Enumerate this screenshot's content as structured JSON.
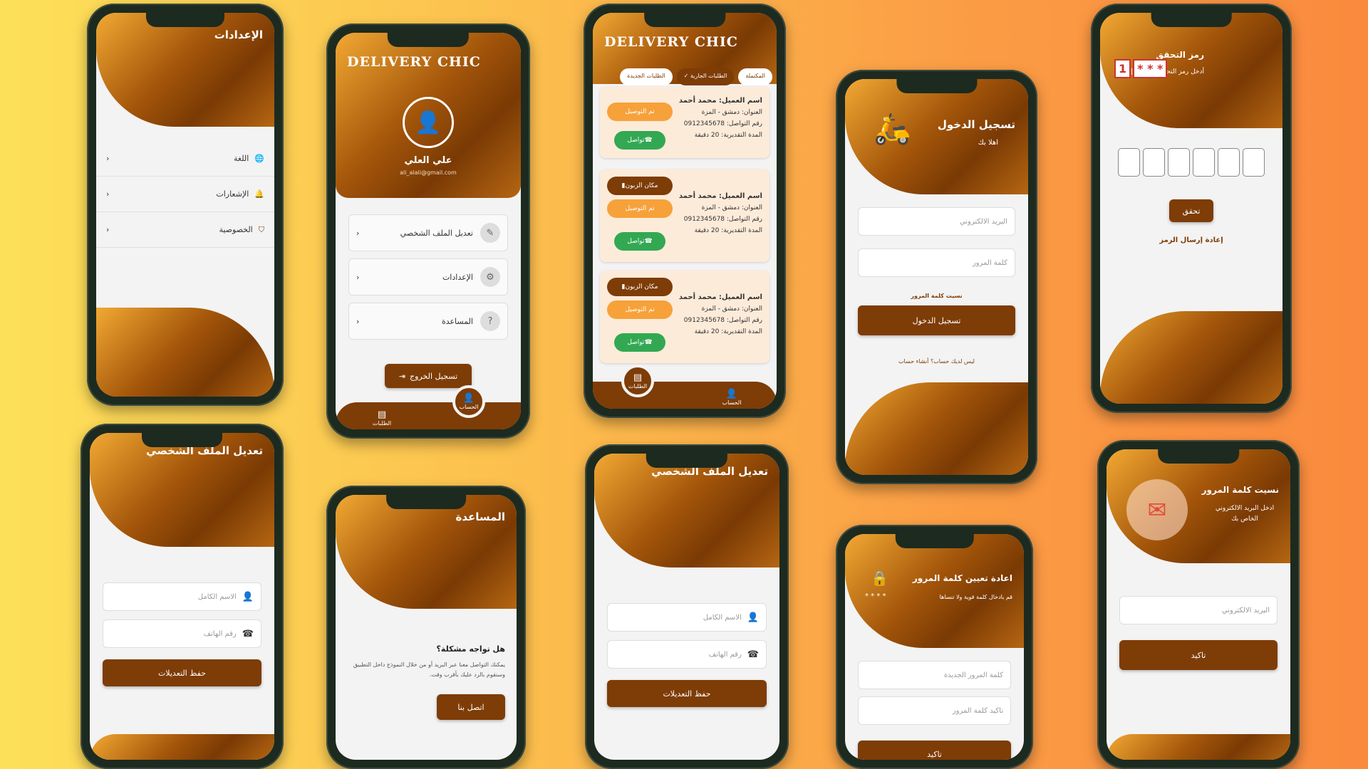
{
  "colors": {
    "brown": "#7e3c06",
    "orange": "#f7a13a",
    "green": "#33a852"
  },
  "settings_screen": {
    "title": "الإعدادات",
    "rows": [
      {
        "label": "اللغة",
        "icon": "globe-icon"
      },
      {
        "label": "الإشعارات",
        "icon": "bell-icon"
      },
      {
        "label": "الخصوصية",
        "icon": "shield-icon"
      }
    ]
  },
  "profile_screen": {
    "brand": "DELIVERY CHIC",
    "user_name": "علي العلي",
    "user_email": "ali_alali@gmail.com",
    "menu": [
      {
        "label": "تعديل الملف الشخصي",
        "icon": "pencil-icon"
      },
      {
        "label": "الإعدادات",
        "icon": "gear-icon"
      },
      {
        "label": "المساعدة",
        "icon": "help-icon"
      }
    ],
    "logout": "تسجيل الخروج",
    "nav": {
      "orders": "الطلبات",
      "account": "الحساب"
    }
  },
  "orders_screen": {
    "brand": "DELIVERY CHIC",
    "tabs": [
      "المكتملة",
      "الطلبات الجارية",
      "الطلبات الجديدة"
    ],
    "cards": [
      {
        "name": "اسم العميل: محمد أحمد",
        "address": "العنوان: دمشق - المزة",
        "phone": "رقم التواصل: 0912345678",
        "eta": "المدة التقديرية: 20 دقيقة"
      },
      {
        "name": "اسم العميل: محمد أحمد",
        "address": "العنوان: دمشق - المزة",
        "phone": "رقم التواصل: 0912345678",
        "eta": "المدة التقديرية: 20 دقيقة"
      },
      {
        "name": "اسم العميل: محمد أحمد",
        "address": "العنوان: دمشق - المزة",
        "phone": "رقم التواصل: 0912345678",
        "eta": "المدة التقديرية: 20 دقيقة"
      }
    ],
    "chip_map": "مكان الزبون",
    "chip_done": "تم التوصيل",
    "chip_call": "تواصل",
    "nav": {
      "orders": "الطلبات",
      "account": "الحساب"
    }
  },
  "login_screen": {
    "title": "تسجيل الدخول",
    "subtitle": "اهلا بك",
    "email_placeholder": "البريد الالكتروني",
    "password_placeholder": "كلمة المرور",
    "forgot": "نسيت كلمة المرور",
    "submit": "تسجيل الدخول",
    "signup": "ليس لديك حساب؟ أنشاء حساب"
  },
  "otp_screen": {
    "title": "رمز التحقق",
    "subtitle": "أدخل رمز التحقق المرسل إلى",
    "verify": "تحقق",
    "resend": "إعادة إرسال الرمز",
    "illustration_digit": "1",
    "illustration_mask": "* * *"
  },
  "edit_profile_a": {
    "title": "تعديل الملف الشخصي",
    "name_placeholder": "الاسم الكامل",
    "phone_placeholder": "رقم الهاتف",
    "save": "حفظ التعديلات"
  },
  "help_screen": {
    "title": "المساعدة",
    "question": "هل تواجه مشكلة؟",
    "body": "يمكنك التواصل معنا عبر البريد أو من خلال النموذج داخل التطبيق وسنقوم بالرد عليك بأقرب وقت.",
    "contact": "اتصل بنا"
  },
  "edit_profile_b": {
    "title": "تعديل الملف الشخصي",
    "name_placeholder": "الاسم الكامل",
    "phone_placeholder": "رقم الهاتف",
    "save": "حفظ التعديلات"
  },
  "reset_screen": {
    "title": "اعادة تعيين كلمة المرور",
    "subtitle": "قم بادخال كلمة قوية ولا تنساها",
    "new_placeholder": "كلمة المرور الجديدة",
    "confirm_placeholder": "تاكيد كلمة المرور",
    "submit": "تاكيد",
    "illustration_mask": "* * * *"
  },
  "forgot_screen": {
    "title": "نسيت كلمة المرور",
    "subtitle": "ادخل البريد الالكتروني الخاص بك",
    "email_placeholder": "البريد الالكتروني",
    "submit": "تاكيد"
  }
}
